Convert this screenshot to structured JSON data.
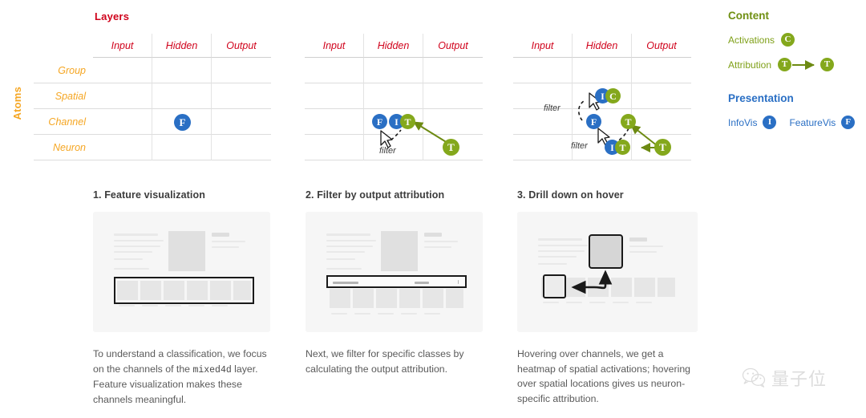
{
  "diagram": {
    "axis_titles": {
      "columns": "Layers",
      "rows": "Atoms"
    },
    "column_headers": [
      "Input",
      "Hidden",
      "Output"
    ],
    "row_headers": [
      "Group",
      "Spatial",
      "Channel",
      "Neuron"
    ],
    "filter_label": "filter",
    "matrices": [
      {
        "id": "matrix-1",
        "caption": "Layers",
        "badges": [
          {
            "label": "F",
            "kind": "featurevis",
            "row": "Channel",
            "col": "Hidden"
          }
        ]
      },
      {
        "id": "matrix-2",
        "badges": [
          {
            "label": "F",
            "kind": "featurevis",
            "row": "Channel",
            "col": "Hidden"
          },
          {
            "label": "I",
            "kind": "infovis",
            "row": "Channel",
            "col": "Hidden"
          },
          {
            "label": "T",
            "kind": "attribution",
            "row": "Channel",
            "col": "Hidden"
          },
          {
            "label": "T",
            "kind": "attribution",
            "row": "Neuron",
            "col": "Output"
          }
        ],
        "filters": [
          "filter"
        ]
      },
      {
        "id": "matrix-3",
        "badges": [
          {
            "label": "I",
            "kind": "infovis",
            "row": "Spatial",
            "col": "Hidden"
          },
          {
            "label": "C",
            "kind": "activations",
            "row": "Spatial",
            "col": "Hidden"
          },
          {
            "label": "F",
            "kind": "featurevis",
            "row": "Channel",
            "col": "Hidden"
          },
          {
            "label": "T",
            "kind": "attribution",
            "row": "Channel",
            "col": "Output"
          },
          {
            "label": "I",
            "kind": "infovis",
            "row": "Neuron",
            "col": "Hidden"
          },
          {
            "label": "T",
            "kind": "attribution",
            "row": "Neuron",
            "col": "Hidden"
          },
          {
            "label": "T",
            "kind": "attribution",
            "row": "Neuron",
            "col": "Output"
          }
        ],
        "filters": [
          "filter",
          "filter"
        ]
      }
    ]
  },
  "legend": {
    "content": {
      "heading": "Content",
      "items": [
        {
          "label": "Activations",
          "glyph": "C"
        },
        {
          "label": "Attribution",
          "glyph": "T"
        }
      ]
    },
    "presentation": {
      "heading": "Presentation",
      "items": [
        {
          "label": "InfoVis",
          "glyph": "I"
        },
        {
          "label": "FeatureVis",
          "glyph": "F"
        }
      ]
    }
  },
  "colors": {
    "red": "#d0021b",
    "orange": "#f5a623",
    "green": "#84a81c",
    "blue": "#2a6fc4",
    "body_text": "#5a5a5a",
    "card_title": "#3c3c3c"
  },
  "cards": [
    {
      "title": "1. Feature visualization",
      "body_pre": "To understand a classification, we focus on the channels of the ",
      "body_code": "mixed4d",
      "body_post": " layer. Feature visualization makes these channels meaningful."
    },
    {
      "title": "2. Filter by output attribution",
      "body_pre": "Next, we filter for specific classes by calculating the output attribution.",
      "body_code": "",
      "body_post": ""
    },
    {
      "title": "3. Drill down on hover",
      "body_pre": "Hovering over channels, we get a heatmap of spatial activations; hovering over spatial locations gives us neuron-specific attribution.",
      "body_code": "",
      "body_post": ""
    }
  ],
  "watermark": {
    "text": "量子位"
  }
}
